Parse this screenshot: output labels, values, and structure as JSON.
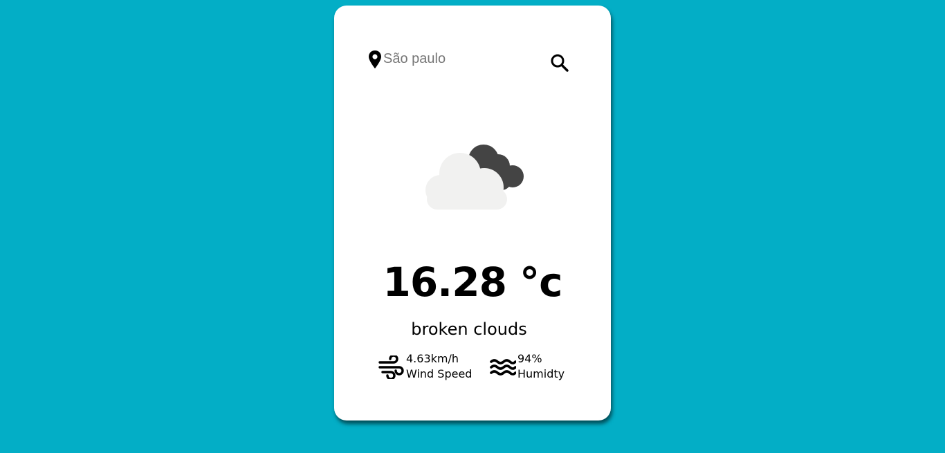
{
  "search": {
    "value": "",
    "placeholder": "São paulo"
  },
  "icons": {
    "location": "location-pin-icon",
    "search": "magnifier-icon",
    "weather": "broken-clouds-icon",
    "wind": "wind-icon",
    "humidity": "water-waves-icon"
  },
  "weather": {
    "temperature": "16.28 °c",
    "description": "broken clouds"
  },
  "details": {
    "wind": {
      "value": "4.63km/h",
      "label": "Wind Speed"
    },
    "humidity": {
      "value": "94%",
      "label": "Humidty"
    }
  },
  "colors": {
    "background": "#03aec6",
    "card": "#ffffff",
    "cloud_light": "#f1f1f0",
    "cloud_dark": "#444444"
  }
}
